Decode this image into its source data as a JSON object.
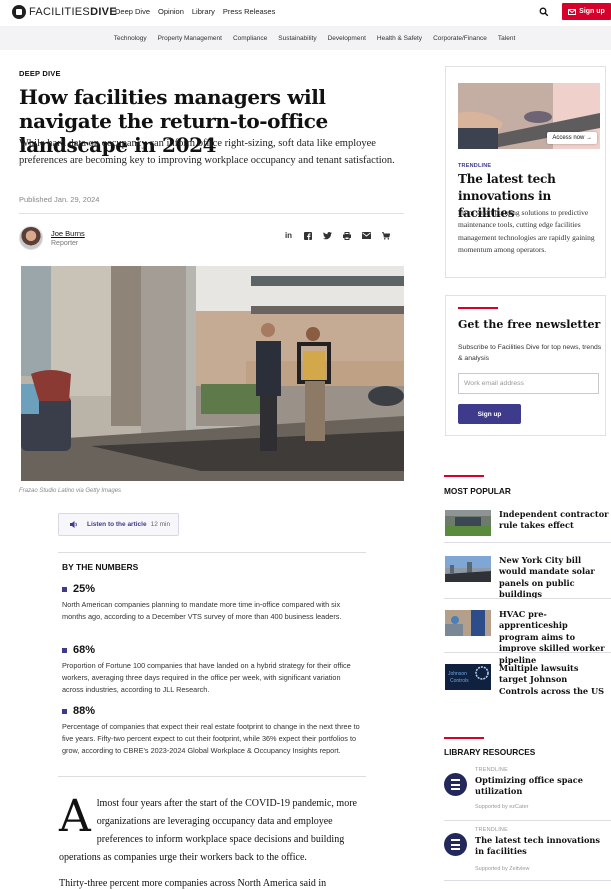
{
  "header": {
    "logo_light": "FACILITIES",
    "logo_bold": "DIVE",
    "nav": [
      "Deep Dive",
      "Opinion",
      "Library",
      "Press Releases"
    ],
    "search_icon": "search-icon",
    "signup_label": "Sign up",
    "signup_icon": "envelope-icon"
  },
  "subnav": [
    "Technology",
    "Property Management",
    "Compliance",
    "Sustainability",
    "Development",
    "Health & Safety",
    "Corporate/Finance",
    "Talent"
  ],
  "colors": {
    "brand_red": "#d7002b",
    "accent_purple": "#3e3a8c",
    "navy": "#23285a"
  },
  "article": {
    "kicker": "DEEP DIVE",
    "title": "How facilities managers will navigate the return-to-office landscape in 2024",
    "dek": "While hard data on occupancy can inform office right-sizing, soft data like employee preferences are becoming key to improving workplace occupancy and tenant satisfaction.",
    "published": "Published Jan. 29, 2024",
    "author": {
      "name": "Joe Burns",
      "role": "Reporter"
    },
    "share_icons": [
      "linkedin-icon",
      "facebook-icon",
      "twitter-icon",
      "print-icon",
      "email-icon",
      "cart-icon"
    ],
    "image_caption": "Frazao Studio Latino via Getty Images",
    "listen": {
      "label": "Listen to the article",
      "duration": "12 min"
    },
    "by_the_numbers": {
      "heading": "BY THE NUMBERS",
      "stats": [
        {
          "value": "25%",
          "desc": "North American companies planning to mandate more time in-office compared with six months ago, according to a December VTS survey of more than 400 business leaders."
        },
        {
          "value": "68%",
          "desc": "Proportion of Fortune 100 companies that have landed on a hybrid strategy for their office workers, averaging three days required in the office per week, with significant variation across industries, according to JLL Research."
        },
        {
          "value": "88%",
          "desc": "Percentage of companies that expect their real estate footprint to change in the next three to five years. Fifty-two percent expect to cut their footprint, while 36% expect their portfolios to grow, according to CBRE's 2023-2024 Global Workplace & Occupancy Insights report."
        }
      ]
    },
    "body": {
      "dropcap": "A",
      "para1": "lmost four years after the start of the COVID-19 pandemic, more organizations are leveraging occupancy data and employee preferences to inform workplace space decisions and building operations as companies urge their workers back to the office.",
      "para2": "Thirty-three percent more companies across North America said in"
    }
  },
  "sidebar": {
    "trendline_card": {
      "access_label": "Access now →",
      "kicker": "TRENDLINE",
      "title": "The latest tech innovations in facilities",
      "desc": "From smart building solutions to predictive maintenance tools, cutting edge facilities management technologies are rapidly gaining momentum among operators."
    },
    "newsletter": {
      "title": "Get the free newsletter",
      "desc": "Subscribe to Facilities Dive for top news, trends & analysis",
      "email_placeholder": "Work email address",
      "button": "Sign up"
    },
    "most_popular": {
      "heading": "MOST POPULAR",
      "items": [
        {
          "title": "Independent contractor rule takes effect"
        },
        {
          "title": "New York City bill would mandate solar panels on public buildings"
        },
        {
          "title": "HVAC pre-apprenticeship program aims to improve skilled worker pipeline"
        },
        {
          "title": "Multiple lawsuits target Johnson Controls across the US",
          "thumb_text": "Johnson Controls"
        }
      ]
    },
    "library": {
      "heading": "LIBRARY RESOURCES",
      "items": [
        {
          "kicker": "TRENDLINE",
          "title": "Optimizing office space utilization",
          "sponsor": "Supported by ezCater"
        },
        {
          "kicker": "TRENDLINE",
          "title": "The latest tech innovations in facilities",
          "sponsor": "Supported by Zeitview"
        }
      ]
    }
  }
}
